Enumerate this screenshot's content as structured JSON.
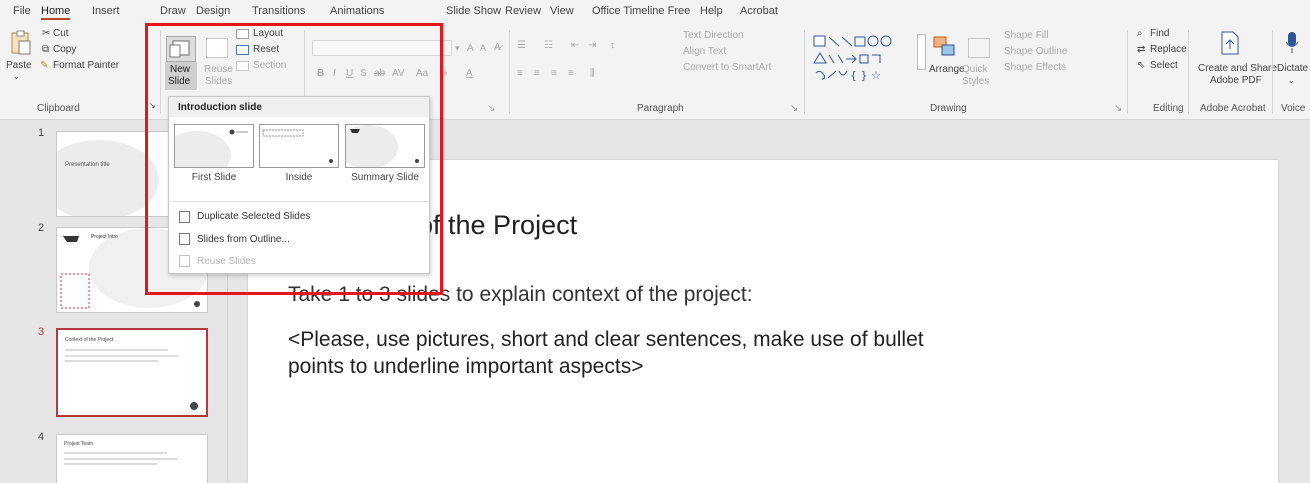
{
  "menu": {
    "items": [
      "File",
      "Home",
      "Insert",
      "Draw",
      "Design",
      "Transitions",
      "Animations",
      "Slide Show",
      "Review",
      "View",
      "Office Timeline Free",
      "Help",
      "Acrobat"
    ],
    "active": "Home"
  },
  "clipboard": {
    "paste": "Paste",
    "cut": "Cut",
    "copy": "Copy",
    "format_painter": "Format Painter",
    "label": "Clipboard"
  },
  "slides_group": {
    "new_slide": "New",
    "new_slide_2": "Slide",
    "reuse": "Reuse",
    "reuse_2": "Slides",
    "layout": "Layout",
    "reset": "Reset",
    "section": "Section"
  },
  "font_group": {
    "grow": "A",
    "shrink": "A"
  },
  "paragraph": {
    "text_direction": "Text Direction",
    "align_text": "Align Text",
    "convert": "Convert to SmartArt",
    "label": "Paragraph"
  },
  "drawing": {
    "arrange": "Arrange",
    "quick_styles": "Quick Styles",
    "shape_fill": "Shape Fill",
    "shape_outline": "Shape Outline",
    "shape_effects": "Shape Effects",
    "label": "Drawing"
  },
  "editing": {
    "find": "Find",
    "replace": "Replace",
    "select": "Select",
    "label": "Editing"
  },
  "acrobat": {
    "create_share": "Create and Share",
    "adobe_pdf": "Adobe PDF",
    "label": "Adobe Acrobat"
  },
  "voice": {
    "dictate": "Dictate",
    "label": "Voice"
  },
  "dropdown": {
    "heading": "Introduction slide",
    "layouts": [
      "First Slide",
      "Inside",
      "Summary Slide"
    ],
    "duplicate": "Duplicate Selected Slides",
    "from_outline": "Slides from Outline...",
    "reuse": "Reuse Slides"
  },
  "thumbnails": {
    "numbers": [
      "1",
      "2",
      "3",
      "4"
    ],
    "t1_title": "Presentation title",
    "t2_title": "Project Intro",
    "t3_title": "Context of the Project",
    "t4_title": "Project Team"
  },
  "slide": {
    "title": "of the Project",
    "line1": "Take 1 to 3 slides to explain context of the project:",
    "line2": "<Please, use pictures, short and clear sentences, make use of bullet",
    "line3": "points to underline important aspects>"
  },
  "colors": {
    "accent": "#b7472a",
    "highlight": "#e4161b",
    "selected_thumb": "#b33a3a"
  }
}
